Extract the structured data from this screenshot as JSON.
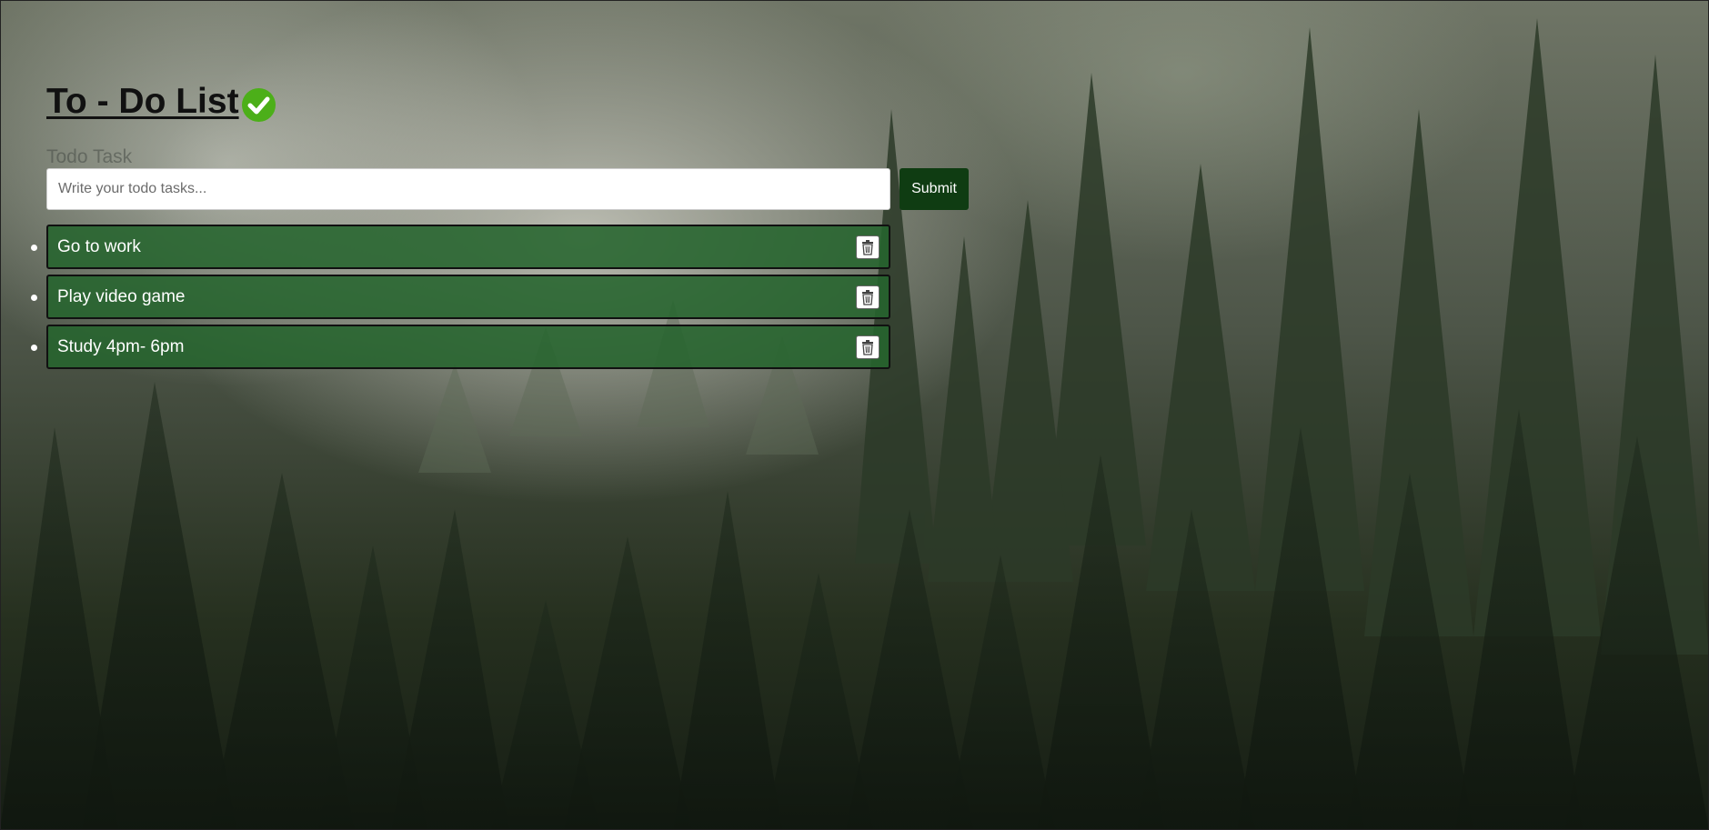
{
  "header": {
    "title": "To - Do List",
    "title_icon": "check-circle-icon",
    "accent_color": "#4caf19"
  },
  "form": {
    "label": "Todo Task",
    "input_value": "",
    "input_placeholder": "Write your todo tasks...",
    "submit_label": "Submit",
    "submit_color": "#0f3c12"
  },
  "tasks": [
    {
      "text": "Go to work",
      "delete_icon": "trash-icon"
    },
    {
      "text": "Play video game",
      "delete_icon": "trash-icon"
    },
    {
      "text": "Study 4pm- 6pm",
      "delete_icon": "trash-icon"
    }
  ],
  "task_color": "#26642d"
}
